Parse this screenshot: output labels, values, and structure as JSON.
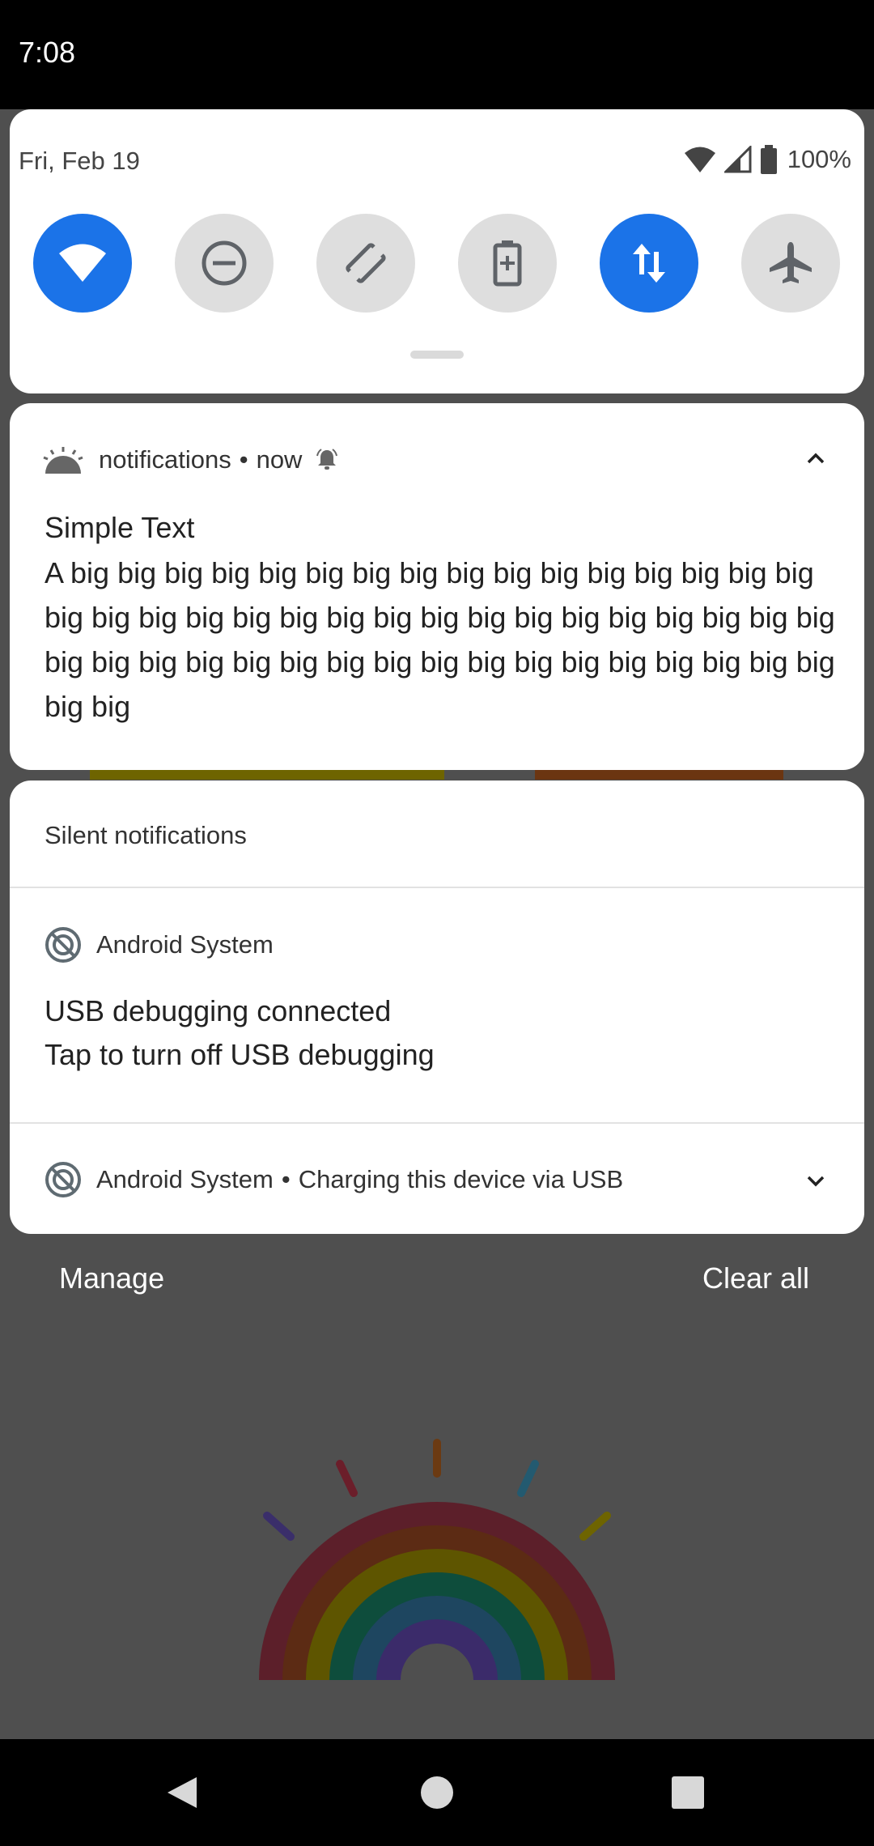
{
  "status_bar": {
    "time": "7:08"
  },
  "quick_settings": {
    "date": "Fri, Feb 19",
    "battery_percent": "100%",
    "tiles": [
      {
        "icon": "wifi-icon",
        "active": true
      },
      {
        "icon": "do-not-disturb-icon",
        "active": false
      },
      {
        "icon": "auto-rotate-icon",
        "active": false
      },
      {
        "icon": "battery-saver-icon",
        "active": false
      },
      {
        "icon": "mobile-data-icon",
        "active": true
      },
      {
        "icon": "airplane-icon",
        "active": false
      }
    ]
  },
  "notification": {
    "app_name": "notifications",
    "separator": "•",
    "time": "now",
    "title": "Simple Text",
    "body": "A big big big big big big big big big big big big big big big big big big big big big big big big big big big big big big big big big big big big big big big big big big big big big big big big big big big big"
  },
  "silent": {
    "header": "Silent notifications",
    "items": [
      {
        "app_name": "Android System",
        "title": "USB debugging connected",
        "text": "Tap to turn off USB debugging"
      },
      {
        "app_name": "Android System",
        "separator": "•",
        "summary": "Charging this device via USB"
      }
    ]
  },
  "footer": {
    "manage": "Manage",
    "clear_all": "Clear all"
  },
  "colors": {
    "accent": "#1b73e8",
    "scrim": "#4f4f4f",
    "tile_off": "#dedede"
  }
}
